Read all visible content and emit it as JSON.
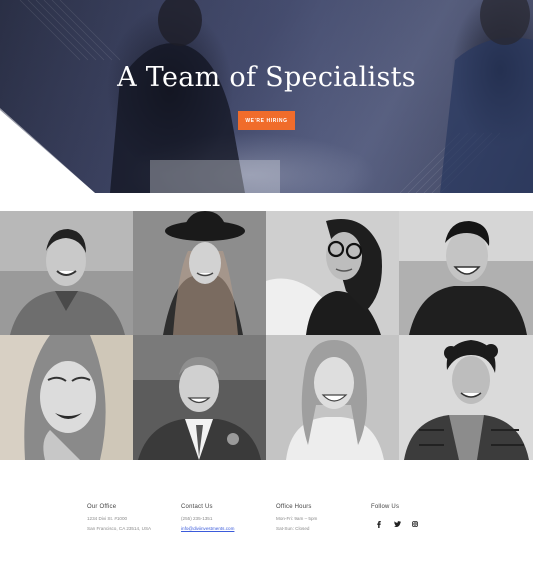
{
  "hero": {
    "title": "A Team of Specialists",
    "button_label": "WE'RE HIRING"
  },
  "team_grid": {
    "photos": [
      {
        "description": "smiling man in denim shirt"
      },
      {
        "description": "woman with black hat"
      },
      {
        "description": "woman with glasses"
      },
      {
        "description": "man in black hoodie laughing"
      },
      {
        "description": "smiling woman with red lipstick"
      },
      {
        "description": "man in suit"
      },
      {
        "description": "smiling woman with long hair"
      },
      {
        "description": "curly-haired man in plaid shirt"
      }
    ]
  },
  "footer": {
    "office": {
      "heading": "Our Office",
      "line1": "1234 Divi St. #1000",
      "line2": "San Francisco, CA 23514, USA"
    },
    "contact": {
      "heading": "Contact Us",
      "phone": "(255) 235-1351",
      "email": "info@diviinvestments.com"
    },
    "hours": {
      "heading": "Office Hours",
      "line1": "Mon-Fri: 9am – 5pm",
      "line2": "Sat-Sun: Closed"
    },
    "social": {
      "heading": "Follow Us",
      "icons": [
        "facebook-icon",
        "twitter-icon",
        "instagram-icon"
      ]
    }
  },
  "colors": {
    "accent": "#f06c2b",
    "hero_dark": "#2a2f45",
    "link": "#3b5bdb"
  }
}
